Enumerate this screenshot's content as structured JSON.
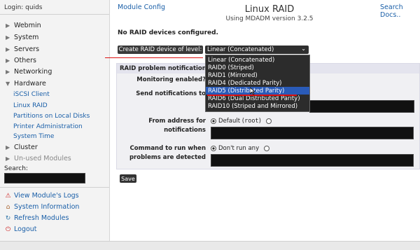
{
  "login": "Login: quids",
  "sidebar": {
    "categories": [
      {
        "label": "Webmin"
      },
      {
        "label": "System"
      },
      {
        "label": "Servers"
      },
      {
        "label": "Others"
      },
      {
        "label": "Networking"
      },
      {
        "label": "Hardware"
      },
      {
        "label": "Cluster"
      },
      {
        "label": "Un-used Modules"
      }
    ],
    "hardware_items": [
      {
        "label": "iSCSI Client"
      },
      {
        "label": "Linux RAID"
      },
      {
        "label": "Partitions on Local Disks"
      },
      {
        "label": "Printer Administration"
      },
      {
        "label": "System Time"
      }
    ],
    "search_label": "Search:",
    "links": [
      {
        "label": "View Module's Logs",
        "icon": "warning-icon"
      },
      {
        "label": "System Information",
        "icon": "house-icon"
      },
      {
        "label": "Refresh Modules",
        "icon": "refresh-icon"
      },
      {
        "label": "Logout",
        "icon": "power-icon"
      }
    ]
  },
  "header": {
    "module_config": "Module Config",
    "search_docs": "Search Docs..",
    "title": "Linux RAID",
    "subtitle": "Using MDADM version 3.2.5"
  },
  "main": {
    "no_raid": "No RAID devices configured.",
    "create_button": "Create RAID device of level:",
    "select_value": "Linear (Concatenated)",
    "dropdown_options": [
      "Linear (Concatenated)",
      "RAID0 (Striped)",
      "RAID1 (Mirrored)",
      "RAID4 (Dedicated Parity)",
      "RAID5 (Distributed Parity)",
      "RAID6 (Dual Distributed Parity)",
      "RAID10 (Striped and Mirrored)"
    ],
    "highlighted_option": "RAID5 (Distributed Parity)",
    "panel_title": "RAID problem notification o",
    "monitoring_label": "Monitoring enabled?",
    "send_label": "Send notifications to",
    "from_label_1": "From address for",
    "from_label_2": "notifications",
    "from_default": "Default (",
    "from_root": "root",
    "from_close": ")",
    "command_label_1": "Command to run when",
    "command_label_2": "problems are detected",
    "command_option": "Don't run any",
    "save": "Save"
  },
  "colors": {
    "link": "#1a5fa8",
    "highlight": "#2a5bb8",
    "annotation_red": "#dd1111"
  }
}
